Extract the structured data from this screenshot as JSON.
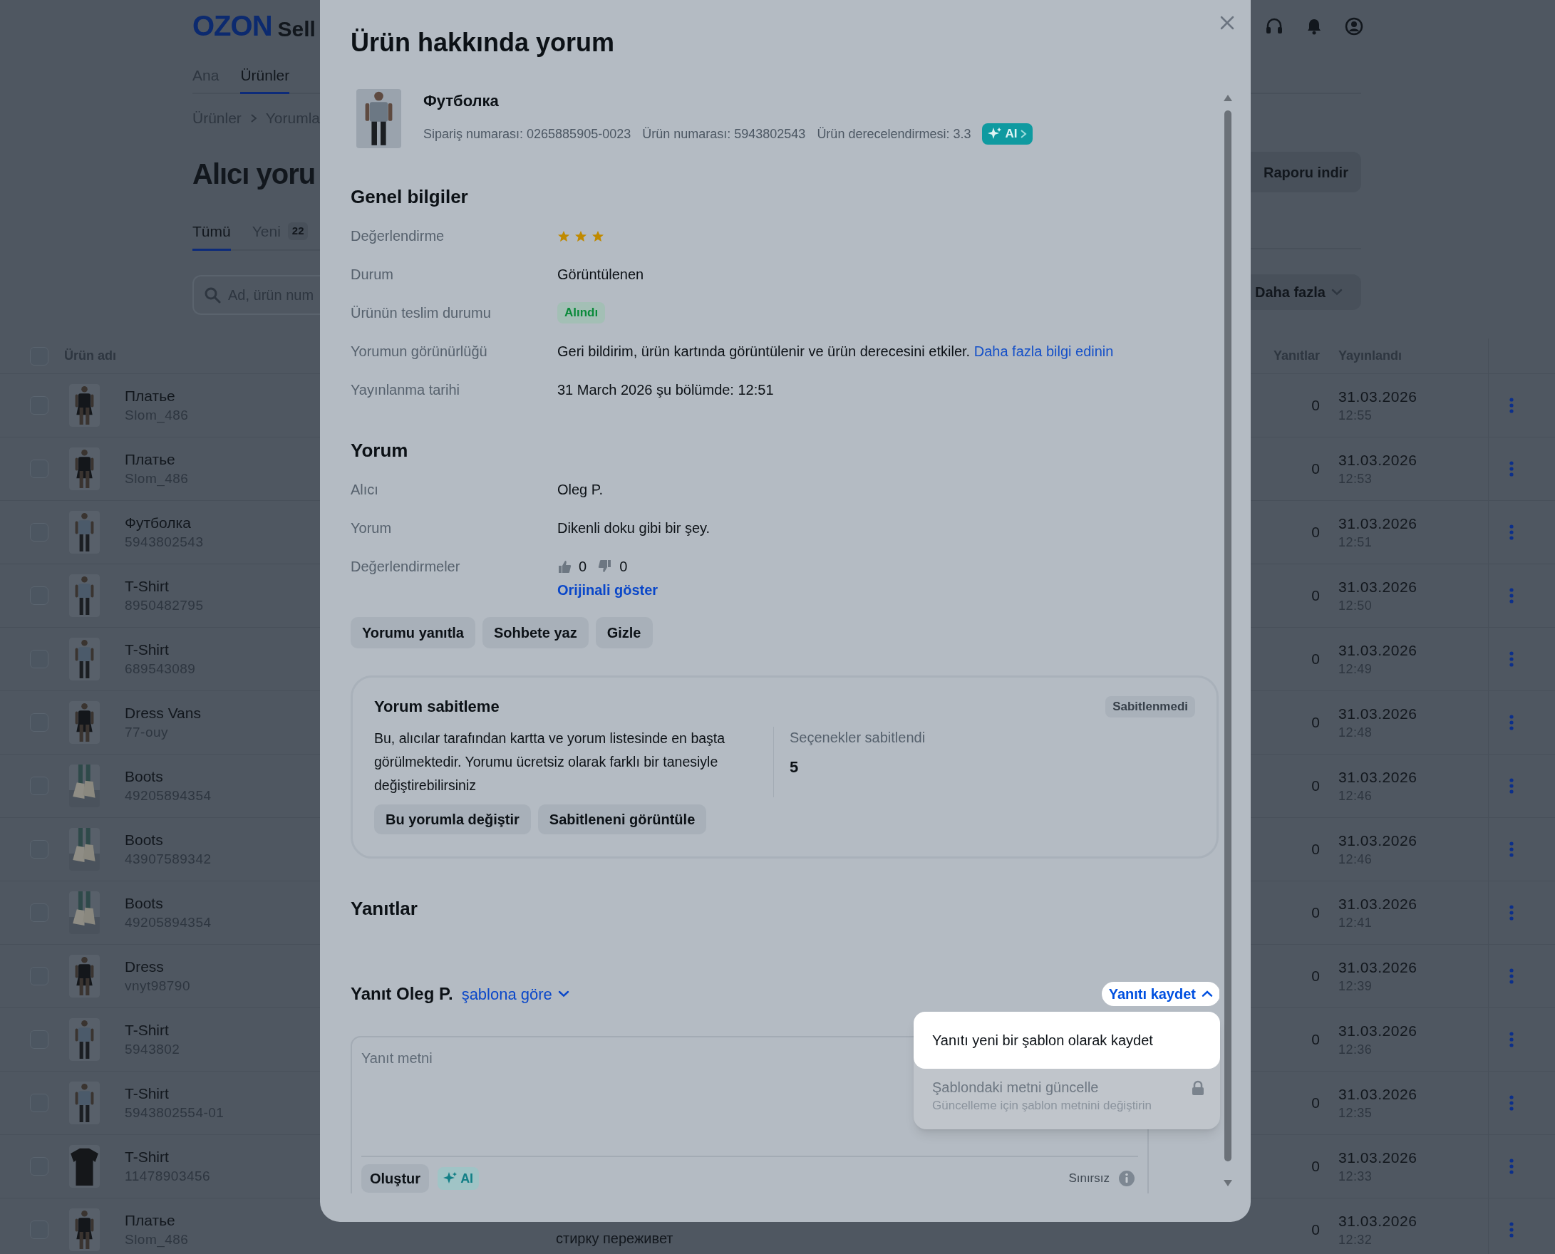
{
  "page": {
    "logo": "OZON",
    "logo_suffix": "Sell",
    "nav": [
      {
        "label": "Ana",
        "selected": false
      },
      {
        "label": "Ürünler",
        "selected": true
      }
    ],
    "breadcrumb": [
      "Ürünler",
      "Yorumla"
    ],
    "title": "Alıcı yoru",
    "tabs": [
      {
        "label": "Tümü",
        "selected": true
      },
      {
        "label": "Yeni",
        "count": "22",
        "selected": false
      }
    ],
    "search": {
      "placeholder": "Ad, ürün num"
    },
    "report_button": "Raporu indir",
    "more_button": "Daha fazla",
    "table": {
      "select_all": {
        "checked": false
      },
      "columns": [
        "Ürün adı",
        "Yanıtlar",
        "Yayınlandı"
      ],
      "rows": [
        {
          "checked": false,
          "name": "Платье",
          "sku": "Slom_486",
          "replies": "0",
          "date": "31.03.2026",
          "time": "12:55"
        },
        {
          "checked": false,
          "name": "Платье",
          "sku": "Slom_486",
          "replies": "0",
          "date": "31.03.2026",
          "time": "12:53"
        },
        {
          "checked": false,
          "name": "Футболка",
          "sku": "5943802543",
          "replies": "0",
          "date": "31.03.2026",
          "time": "12:51"
        },
        {
          "checked": false,
          "name": "T-Shirt",
          "sku": "8950482795",
          "replies": "0",
          "date": "31.03.2026",
          "time": "12:50"
        },
        {
          "checked": false,
          "name": "T-Shirt",
          "sku": "689543089",
          "replies": "0",
          "date": "31.03.2026",
          "time": "12:49"
        },
        {
          "checked": false,
          "name": "Dress Vans",
          "sku": "77-ouy",
          "replies": "0",
          "date": "31.03.2026",
          "time": "12:48"
        },
        {
          "checked": false,
          "name": "Boots",
          "sku": "49205894354",
          "replies": "0",
          "date": "31.03.2026",
          "time": "12:46"
        },
        {
          "checked": false,
          "name": "Boots",
          "sku": "43907589342",
          "replies": "0",
          "date": "31.03.2026",
          "time": "12:46"
        },
        {
          "checked": false,
          "name": "Boots",
          "sku": "49205894354",
          "replies": "0",
          "date": "31.03.2026",
          "time": "12:41"
        },
        {
          "checked": false,
          "name": "Dress",
          "sku": "vnyt98790",
          "replies": "0",
          "date": "31.03.2026",
          "time": "12:39"
        },
        {
          "checked": false,
          "name": "T-Shirt",
          "sku": "5943802",
          "replies": "0",
          "date": "31.03.2026",
          "time": "12:36"
        },
        {
          "checked": false,
          "name": "T-Shirt",
          "sku": "5943802554-01",
          "replies": "0",
          "date": "31.03.2026",
          "time": "12:35"
        },
        {
          "checked": false,
          "name": "T-Shirt",
          "sku": "11478903456",
          "replies": "0",
          "date": "31.03.2026",
          "time": "12:33"
        },
        {
          "checked": false,
          "name": "Платье",
          "sku": "Slom_486",
          "replies": "0",
          "date": "31.03.2026",
          "time": "12:32",
          "comment": "стирку переживет"
        }
      ]
    }
  },
  "modal": {
    "title": "Ürün hakkında yorum",
    "product": {
      "name": "Футболка",
      "meta": [
        "Sipariş numarası: 0265885905-0023",
        "Ürün numarası: 5943802543",
        "Ürün derecelendirmesi: 3.3"
      ],
      "ai": "AI"
    },
    "general": {
      "heading": "Genel bilgiler",
      "rows": [
        {
          "label": "Değerlendirme",
          "kind": "stars",
          "stars": 3
        },
        {
          "label": "Durum",
          "kind": "text",
          "value": "Görüntülenen"
        },
        {
          "label": "Ürünün teslim durumu",
          "kind": "badge",
          "value": "Alındı"
        },
        {
          "label": "Yorumun görünürlüğü",
          "kind": "text",
          "value": "Geri bildirim, ürün kartında görüntülenir ve ürün derecesini etkiler.",
          "link": "Daha fazla bilgi edinin"
        },
        {
          "label": "Yayınlanma tarihi",
          "kind": "text",
          "value": "31 March 2026 şu bölümde: 12:51"
        }
      ]
    },
    "comment": {
      "heading": "Yorum",
      "rows": [
        {
          "label": "Alıcı",
          "kind": "text",
          "value": "Oleg P."
        },
        {
          "label": "Yorum",
          "kind": "text",
          "value": "Dikenli doku gibi bir şey."
        },
        {
          "label": "Değerlendirmeler",
          "kind": "votes",
          "likes": "0",
          "dislikes": "0",
          "link": "Orijinali göster"
        }
      ],
      "buttons": [
        "Yorumu yanıtla",
        "Sohbete yaz",
        "Gizle"
      ]
    },
    "pin": {
      "title": "Yorum sabitleme",
      "status": "Sabitlenmedi",
      "text": "Bu, alıcılar tarafından kartta ve yorum listesinde en başta görülmektedir. Yorumu ücretsiz olarak farklı bir tanesiyle değiştirebilirsiniz",
      "stat_label": "Seçenekler sabitlendi",
      "stat_value": "5",
      "buttons": [
        "Bu yorumla değiştir",
        "Sabitleneni görüntüle"
      ]
    },
    "replies": {
      "heading": "Yanıtlar"
    },
    "reply": {
      "title": "Yanıt Oleg P.",
      "template": "şablona göre",
      "save": "Yanıtı kaydet",
      "menu_open": true,
      "placeholder": "Yanıt metni",
      "generate": "Oluştur",
      "ai": "AI",
      "limit": "Sınırsız"
    },
    "menu": [
      {
        "label": "Yanıtı yeni bir şablon olarak kaydet",
        "disabled": false,
        "highlighted": true
      },
      {
        "label": "Şablondaki metni güncelle",
        "hint": "Güncelleme için şablon metnini değiştirin",
        "disabled": true,
        "highlighted": false
      }
    ]
  }
}
